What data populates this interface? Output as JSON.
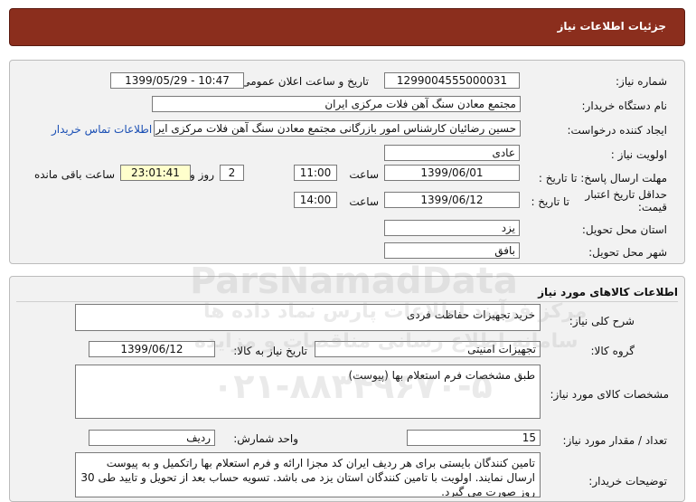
{
  "header": {
    "title": "جزئیات اطلاعات نیاز"
  },
  "info": {
    "need_number_label": "شماره نیاز:",
    "need_number": "1299004555000031",
    "announce_label": "تاریخ و ساعت اعلان عمومی:",
    "announce_value": "1399/05/29 - 10:47",
    "buyer_label": "نام دستگاه خریدار:",
    "buyer_value": "مجتمع معادن سنگ آهن فلات مرکزی ایران",
    "creator_label": "ایجاد کننده درخواست:",
    "creator_value": "حسین رضائیان کارشناس امور بازرگانی مجتمع معادن سنگ آهن فلات مرکزی ایران",
    "contact_link": "اطلاعات تماس خریدار",
    "priority_label": "اولویت نیاز :",
    "priority_value": "عادی",
    "reply_label": "مهلت ارسال پاسخ:  تا تاریخ :",
    "reply_date": "1399/06/01",
    "hour_label": "ساعت",
    "reply_time": "11:00",
    "days_value": "2",
    "days_label": "روز و",
    "remaining_time": "23:01:41",
    "remaining_label": "ساعت باقی مانده",
    "validity_label": "حداقل تاریخ اعتبار قیمت:",
    "validity_until": "تا تاریخ :",
    "validity_date": "1399/06/12",
    "validity_hour_label": "ساعت",
    "validity_time": "14:00",
    "province_label": "استان محل تحویل:",
    "province_value": "یزد",
    "city_label": "شهر محل تحویل:",
    "city_value": "بافق"
  },
  "goods": {
    "section_title": "اطلاعات کالاهای مورد نیاز",
    "general_desc_label": "شرح کلی نیاز:",
    "general_desc_value": "خرید تجهیزات حفاظت فردی",
    "group_label": "گروه کالا:",
    "group_value": "تجهیزات امنیتی",
    "need_date_label": "تاریخ نیاز به کالا:",
    "need_date_value": "1399/06/12",
    "spec_label": "مشخصات کالای مورد نیاز:",
    "spec_value": "طبق مشخصات فرم استعلام بها (پیوست)",
    "qty_label": "تعداد / مقدار مورد نیاز:",
    "qty_value": "15",
    "unit_label": "واحد شمارش:",
    "unit_value": "ردیف",
    "notes_label": "توضیحات خریدار:",
    "notes_value": "تامین کنندگان بایستی برای هر ردیف ایران کد مجزا ارائه و فرم استعلام بها راتکمیل و به پیوست ارسال نمایند. اولویت با تامین کنندگان استان یزد می باشد. تسویه حساب بعد از تحویل و تایید طی 30 روز صورت می گیرد."
  },
  "watermark": {
    "brand": "ParsNamadData",
    "line1": "مرکز فرآیند اطلاعات پارس نماد داده ها",
    "line2": "سامانه اطلاع رسانی مناقصات و مزایده",
    "phone": "۰۲۱-۸۸۳۴۹۶۷۰-۵"
  }
}
